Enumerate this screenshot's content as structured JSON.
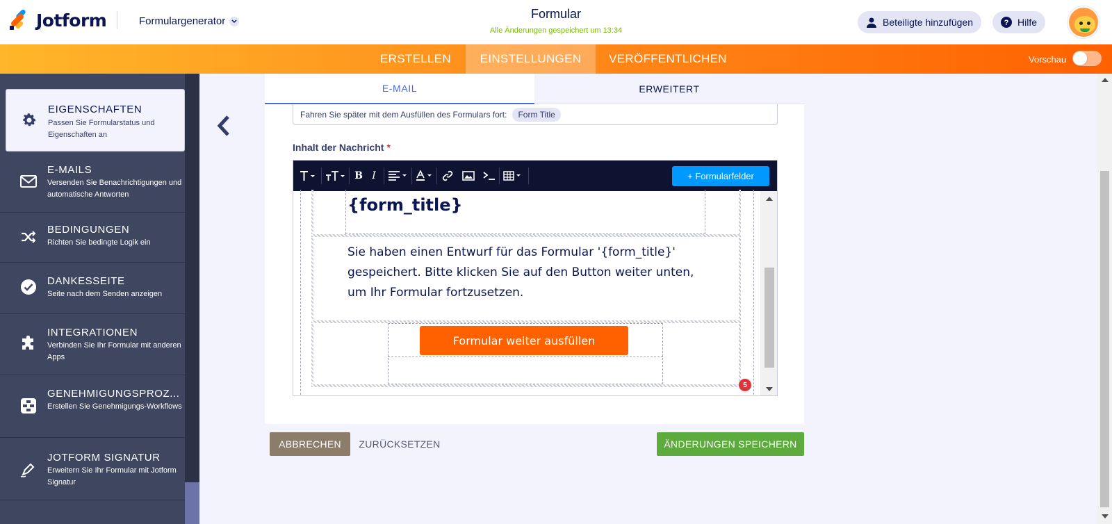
{
  "header": {
    "brand": "Jotform",
    "builder_label": "Formulargenerator",
    "form_title": "Formular",
    "save_status": "Alle Änderungen gespeichert um 13:34",
    "add_participants": "Beteiligte hinzufügen",
    "help": "Hilfe"
  },
  "nav": {
    "tabs": [
      "ERSTELLEN",
      "EINSTELLUNGEN",
      "VERÖFFENTLICHEN"
    ],
    "active_tab": "EINSTELLUNGEN",
    "preview_label": "Vorschau",
    "preview_on": false
  },
  "sidebar": {
    "items": [
      {
        "title": "EIGENSCHAFTEN",
        "desc": "Passen Sie Formularstatus und Eigenschaften an",
        "icon": "gear-icon",
        "active": true
      },
      {
        "title": "E-MAILS",
        "desc": "Versenden Sie Benachrichtigungen und automatische Antworten",
        "icon": "envelope-icon",
        "active": false
      },
      {
        "title": "BEDINGUNGEN",
        "desc": "Richten Sie bedingte Logik ein",
        "icon": "shuffle-icon",
        "active": false
      },
      {
        "title": "DANKESSEITE",
        "desc": "Seite nach dem Senden anzeigen",
        "icon": "check-circle-icon",
        "active": false
      },
      {
        "title": "INTEGRATIONEN",
        "desc": "Verbinden Sie Ihr Formular mit anderen Apps",
        "icon": "puzzle-icon",
        "active": false
      },
      {
        "title": "GENEHMIGUNGSPROZ...",
        "desc": "Erstellen Sie Genehmigungs-Workflows",
        "icon": "workflow-icon",
        "active": false
      },
      {
        "title": "JOTFORM SIGNATUR",
        "desc": "Erweitern Sie Ihr Formular mit Jotform Signatur",
        "icon": "pen-icon",
        "active": false
      }
    ]
  },
  "panel": {
    "tabs": [
      "E-MAIL",
      "ERWEITERT"
    ],
    "active_tab": "E-MAIL",
    "resume_text": "Fahren Sie später mit dem Ausfüllen des Formulars fort:",
    "resume_chip": "Form Title",
    "message_label": "Inhalt der Nachricht",
    "required_mark": "*",
    "toolbar": {
      "icons": [
        "font-icon",
        "font-size-icon",
        "bold-icon",
        "italic-icon",
        "align-icon",
        "font-color-icon",
        "link-icon",
        "image-icon",
        "code-icon",
        "table-icon"
      ],
      "fields_button": "+ Formularfelder"
    },
    "email": {
      "title_token": "{form_title}",
      "body": "Sie haben einen Entwurf für das Formular '{form_title}' gespeichert. Bitte klicken Sie auf den Button weiter unten, um Ihr Formular fortzusetzen.",
      "cta": "Formular weiter ausfüllen"
    },
    "badge_count": "5"
  },
  "actions": {
    "cancel": "ABBRECHEN",
    "reset": "ZURÜCKSETZEN",
    "save": "ÄNDERUNGEN SPEICHERN"
  }
}
